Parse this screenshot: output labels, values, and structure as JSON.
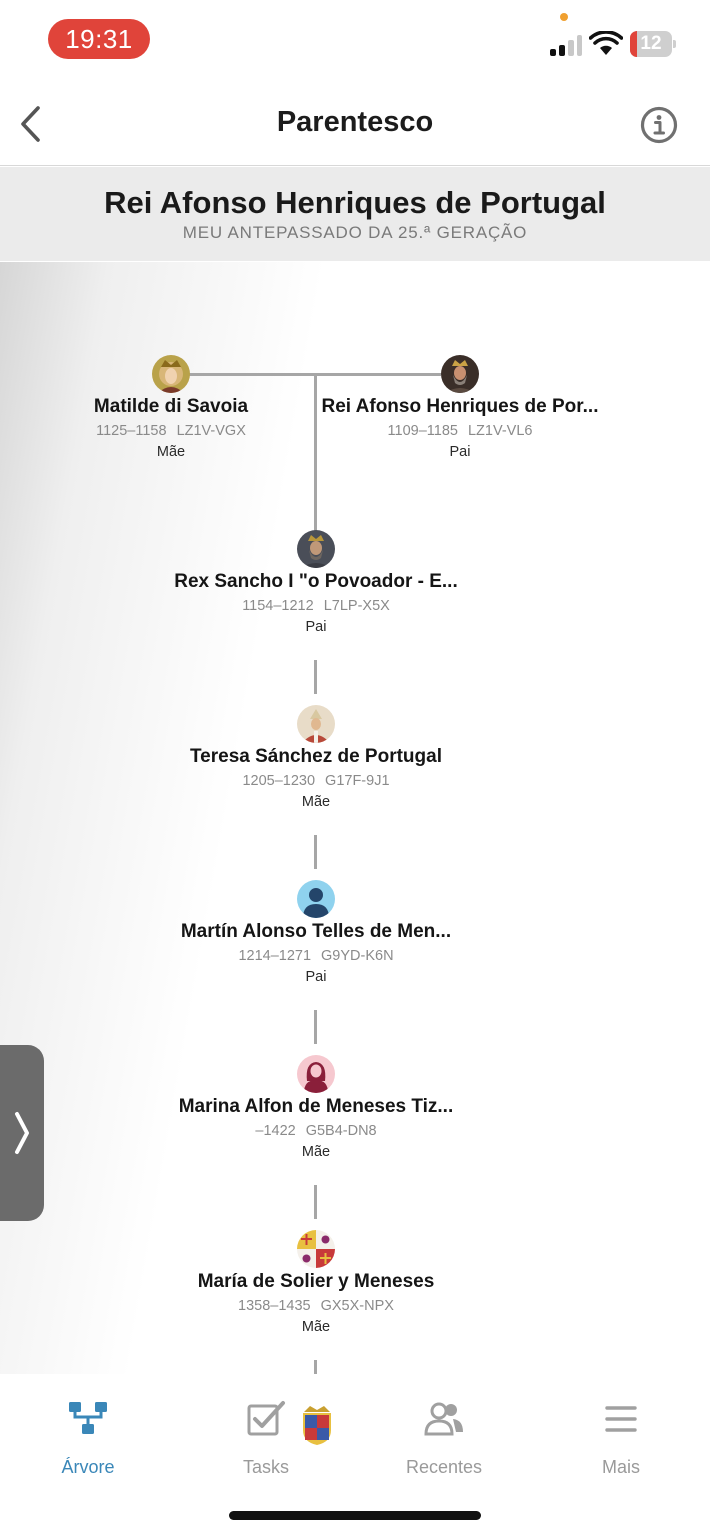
{
  "status_bar": {
    "time": "19:31",
    "battery": "12"
  },
  "nav": {
    "title": "Parentesco"
  },
  "header": {
    "title": "Rei Afonso Henriques de Portugal",
    "subtitle": "MEU ANTEPASSADO DA 25.ª GERAÇÃO"
  },
  "tree": {
    "parents": [
      {
        "name": "Matilde di Savoia",
        "years": "1125–1158",
        "id": "LZ1V-VGX",
        "relation": "Mãe",
        "avatar": "portrait-queen-icon"
      },
      {
        "name": "Rei Afonso Henriques de Por...",
        "years": "1109–1185",
        "id": "LZ1V-VL6",
        "relation": "Pai",
        "avatar": "portrait-king-icon"
      }
    ],
    "line": [
      {
        "name": "Rex Sancho I \"o Povoador - E...",
        "years": "1154–1212",
        "id": "L7LP-X5X",
        "relation": "Pai",
        "avatar": "portrait-king-icon"
      },
      {
        "name": "Teresa Sánchez de Portugal",
        "years": "1205–1230",
        "id": "G17F-9J1",
        "relation": "Mãe",
        "avatar": "portrait-saint-icon"
      },
      {
        "name": "Martín Alonso Telles de Men...",
        "years": "1214–1271",
        "id": "G9YD-K6N",
        "relation": "Pai",
        "avatar": "male-silhouette-icon"
      },
      {
        "name": "Marina Alfon de Meneses Tiz...",
        "years": "–1422",
        "id": "G5B4-DN8",
        "relation": "Mãe",
        "avatar": "female-silhouette-icon"
      },
      {
        "name": "María de Solier y Meneses",
        "years": "1358–1435",
        "id": "GX5X-NPX",
        "relation": "Mãe",
        "avatar": "coat-of-arms-icon"
      }
    ]
  },
  "tabs": [
    {
      "label": "Árvore",
      "icon": "tree-icon",
      "active": true
    },
    {
      "label": "Tasks",
      "icon": "tasks-checkbox-icon",
      "active": false
    },
    {
      "label": "Recentes",
      "icon": "people-icon",
      "active": false
    },
    {
      "label": "Mais",
      "icon": "menu-icon",
      "active": false
    }
  ],
  "colors": {
    "accent": "#3a87b8",
    "status_pill": "#e0443a",
    "connector": "#a6a6a6"
  }
}
